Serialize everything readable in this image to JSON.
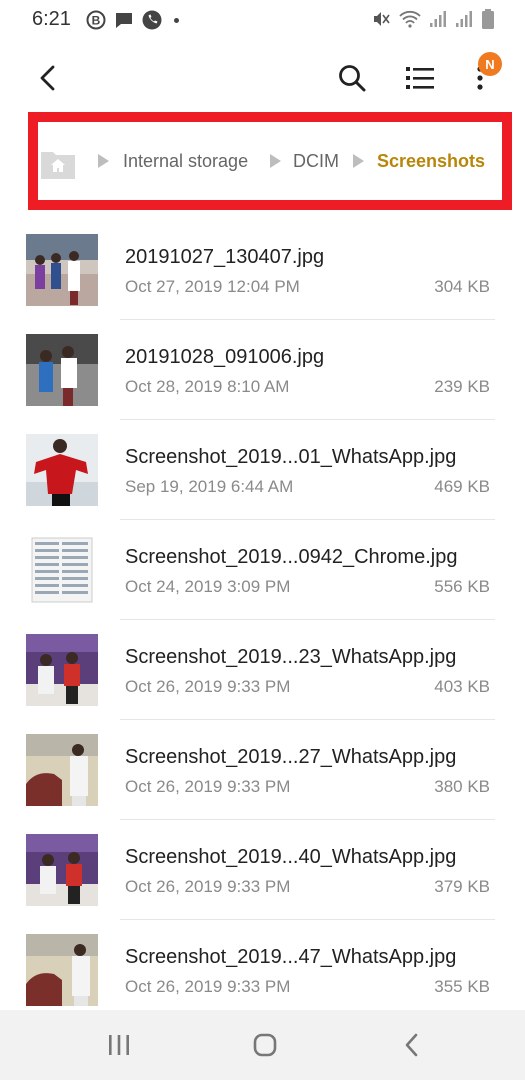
{
  "status_bar": {
    "time": "6:21",
    "left_icons": [
      "b-circle-icon",
      "message-icon",
      "phone-icon"
    ],
    "right_icons": [
      "mute-icon",
      "wifi-icon",
      "signal-icon",
      "signal-icon",
      "battery-icon"
    ]
  },
  "app_bar": {
    "badge": "N"
  },
  "breadcrumb": {
    "items": [
      "Internal storage",
      "DCIM",
      "Screenshots"
    ],
    "active_color": "#b8860b",
    "highlight_color": "#ee1c24"
  },
  "files": [
    {
      "name": "20191027_130407.jpg",
      "date": "Oct 27, 2019 12:04 PM",
      "size": "304 KB"
    },
    {
      "name": "20191028_091006.jpg",
      "date": "Oct 28, 2019 8:10 AM",
      "size": "239 KB"
    },
    {
      "name": "Screenshot_2019...01_WhatsApp.jpg",
      "date": "Sep 19, 2019 6:44 AM",
      "size": "469 KB"
    },
    {
      "name": "Screenshot_2019...0942_Chrome.jpg",
      "date": "Oct 24, 2019 3:09 PM",
      "size": "556 KB"
    },
    {
      "name": "Screenshot_2019...23_WhatsApp.jpg",
      "date": "Oct 26, 2019 9:33 PM",
      "size": "403 KB"
    },
    {
      "name": "Screenshot_2019...27_WhatsApp.jpg",
      "date": "Oct 26, 2019 9:33 PM",
      "size": "380 KB"
    },
    {
      "name": "Screenshot_2019...40_WhatsApp.jpg",
      "date": "Oct 26, 2019 9:33 PM",
      "size": "379 KB"
    },
    {
      "name": "Screenshot_2019...47_WhatsApp.jpg",
      "date": "Oct 26, 2019 9:33 PM",
      "size": "355 KB"
    }
  ],
  "nav_bar": {
    "buttons": [
      "recents-icon",
      "home-icon",
      "back-icon"
    ]
  }
}
